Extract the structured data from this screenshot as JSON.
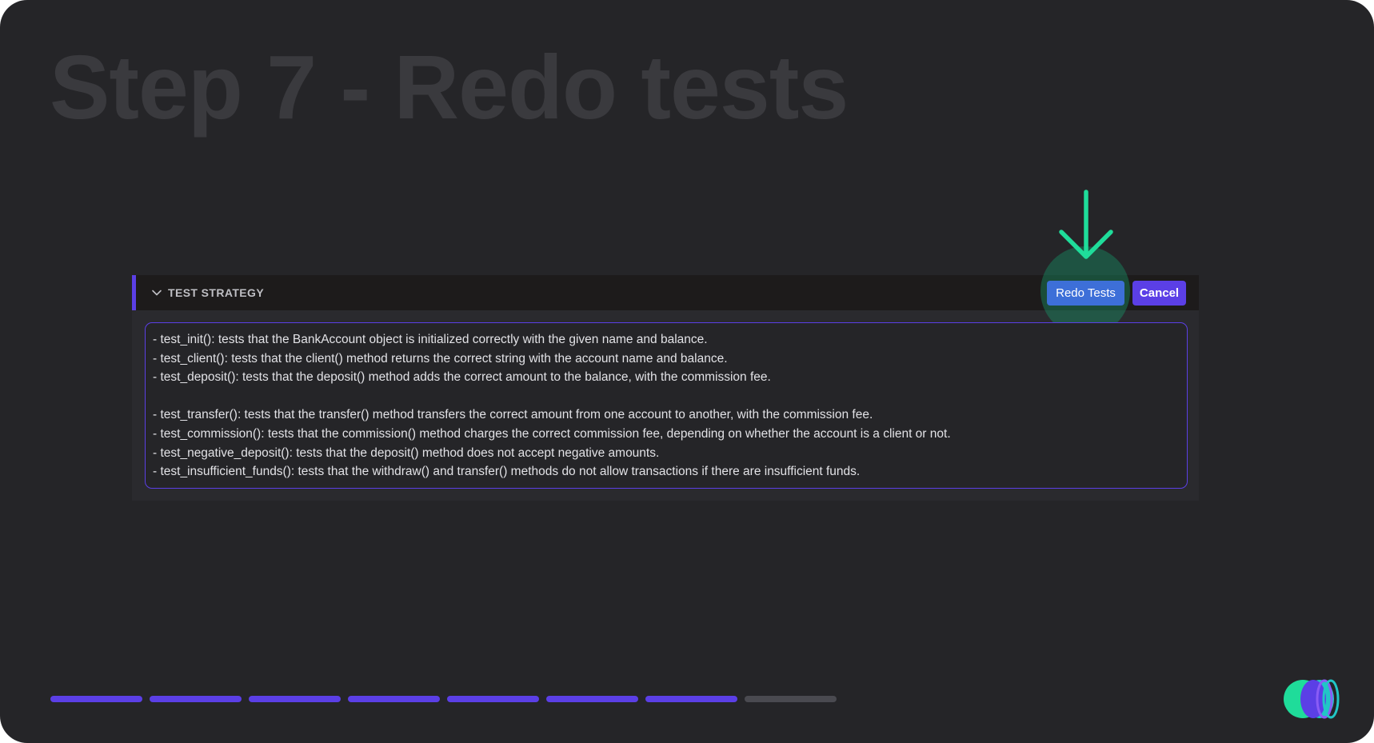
{
  "slide": {
    "title": "Step 7 - Redo tests"
  },
  "panel": {
    "header_title": "TEST STRATEGY",
    "chevron_icon": "chevron-down-icon",
    "redo_button": "Redo Tests",
    "cancel_button": "Cancel",
    "lines": [
      "- test_init(): tests that the BankAccount object is initialized correctly with the given name and balance.",
      "- test_client(): tests that the client() method returns the correct string with the account name and balance.",
      "- test_deposit(): tests that the deposit() method adds the correct amount to the balance, with the commission fee.",
      "",
      "- test_transfer(): tests that the transfer() method transfers the correct amount from one account to another, with the commission fee.",
      "- test_commission(): tests that the commission() method charges the correct commission fee, depending on whether the account is a client or not.",
      "- test_negative_deposit(): tests that the deposit() method does not accept negative amounts.",
      "- test_insufficient_funds(): tests that the withdraw() and transfer() methods do not allow transactions if there are insufficient funds."
    ]
  },
  "annotation": {
    "icon": "arrow-down-icon",
    "color": "#1fdc9a"
  },
  "progress": {
    "total_steps": 8,
    "completed_steps": 7,
    "active_color": "#5b3fe6",
    "inactive_color": "#4a4a50"
  },
  "brand": {
    "icon": "logo-icon",
    "colors": [
      "#1fdc9a",
      "#5b3fe6",
      "#21c6c6"
    ]
  }
}
